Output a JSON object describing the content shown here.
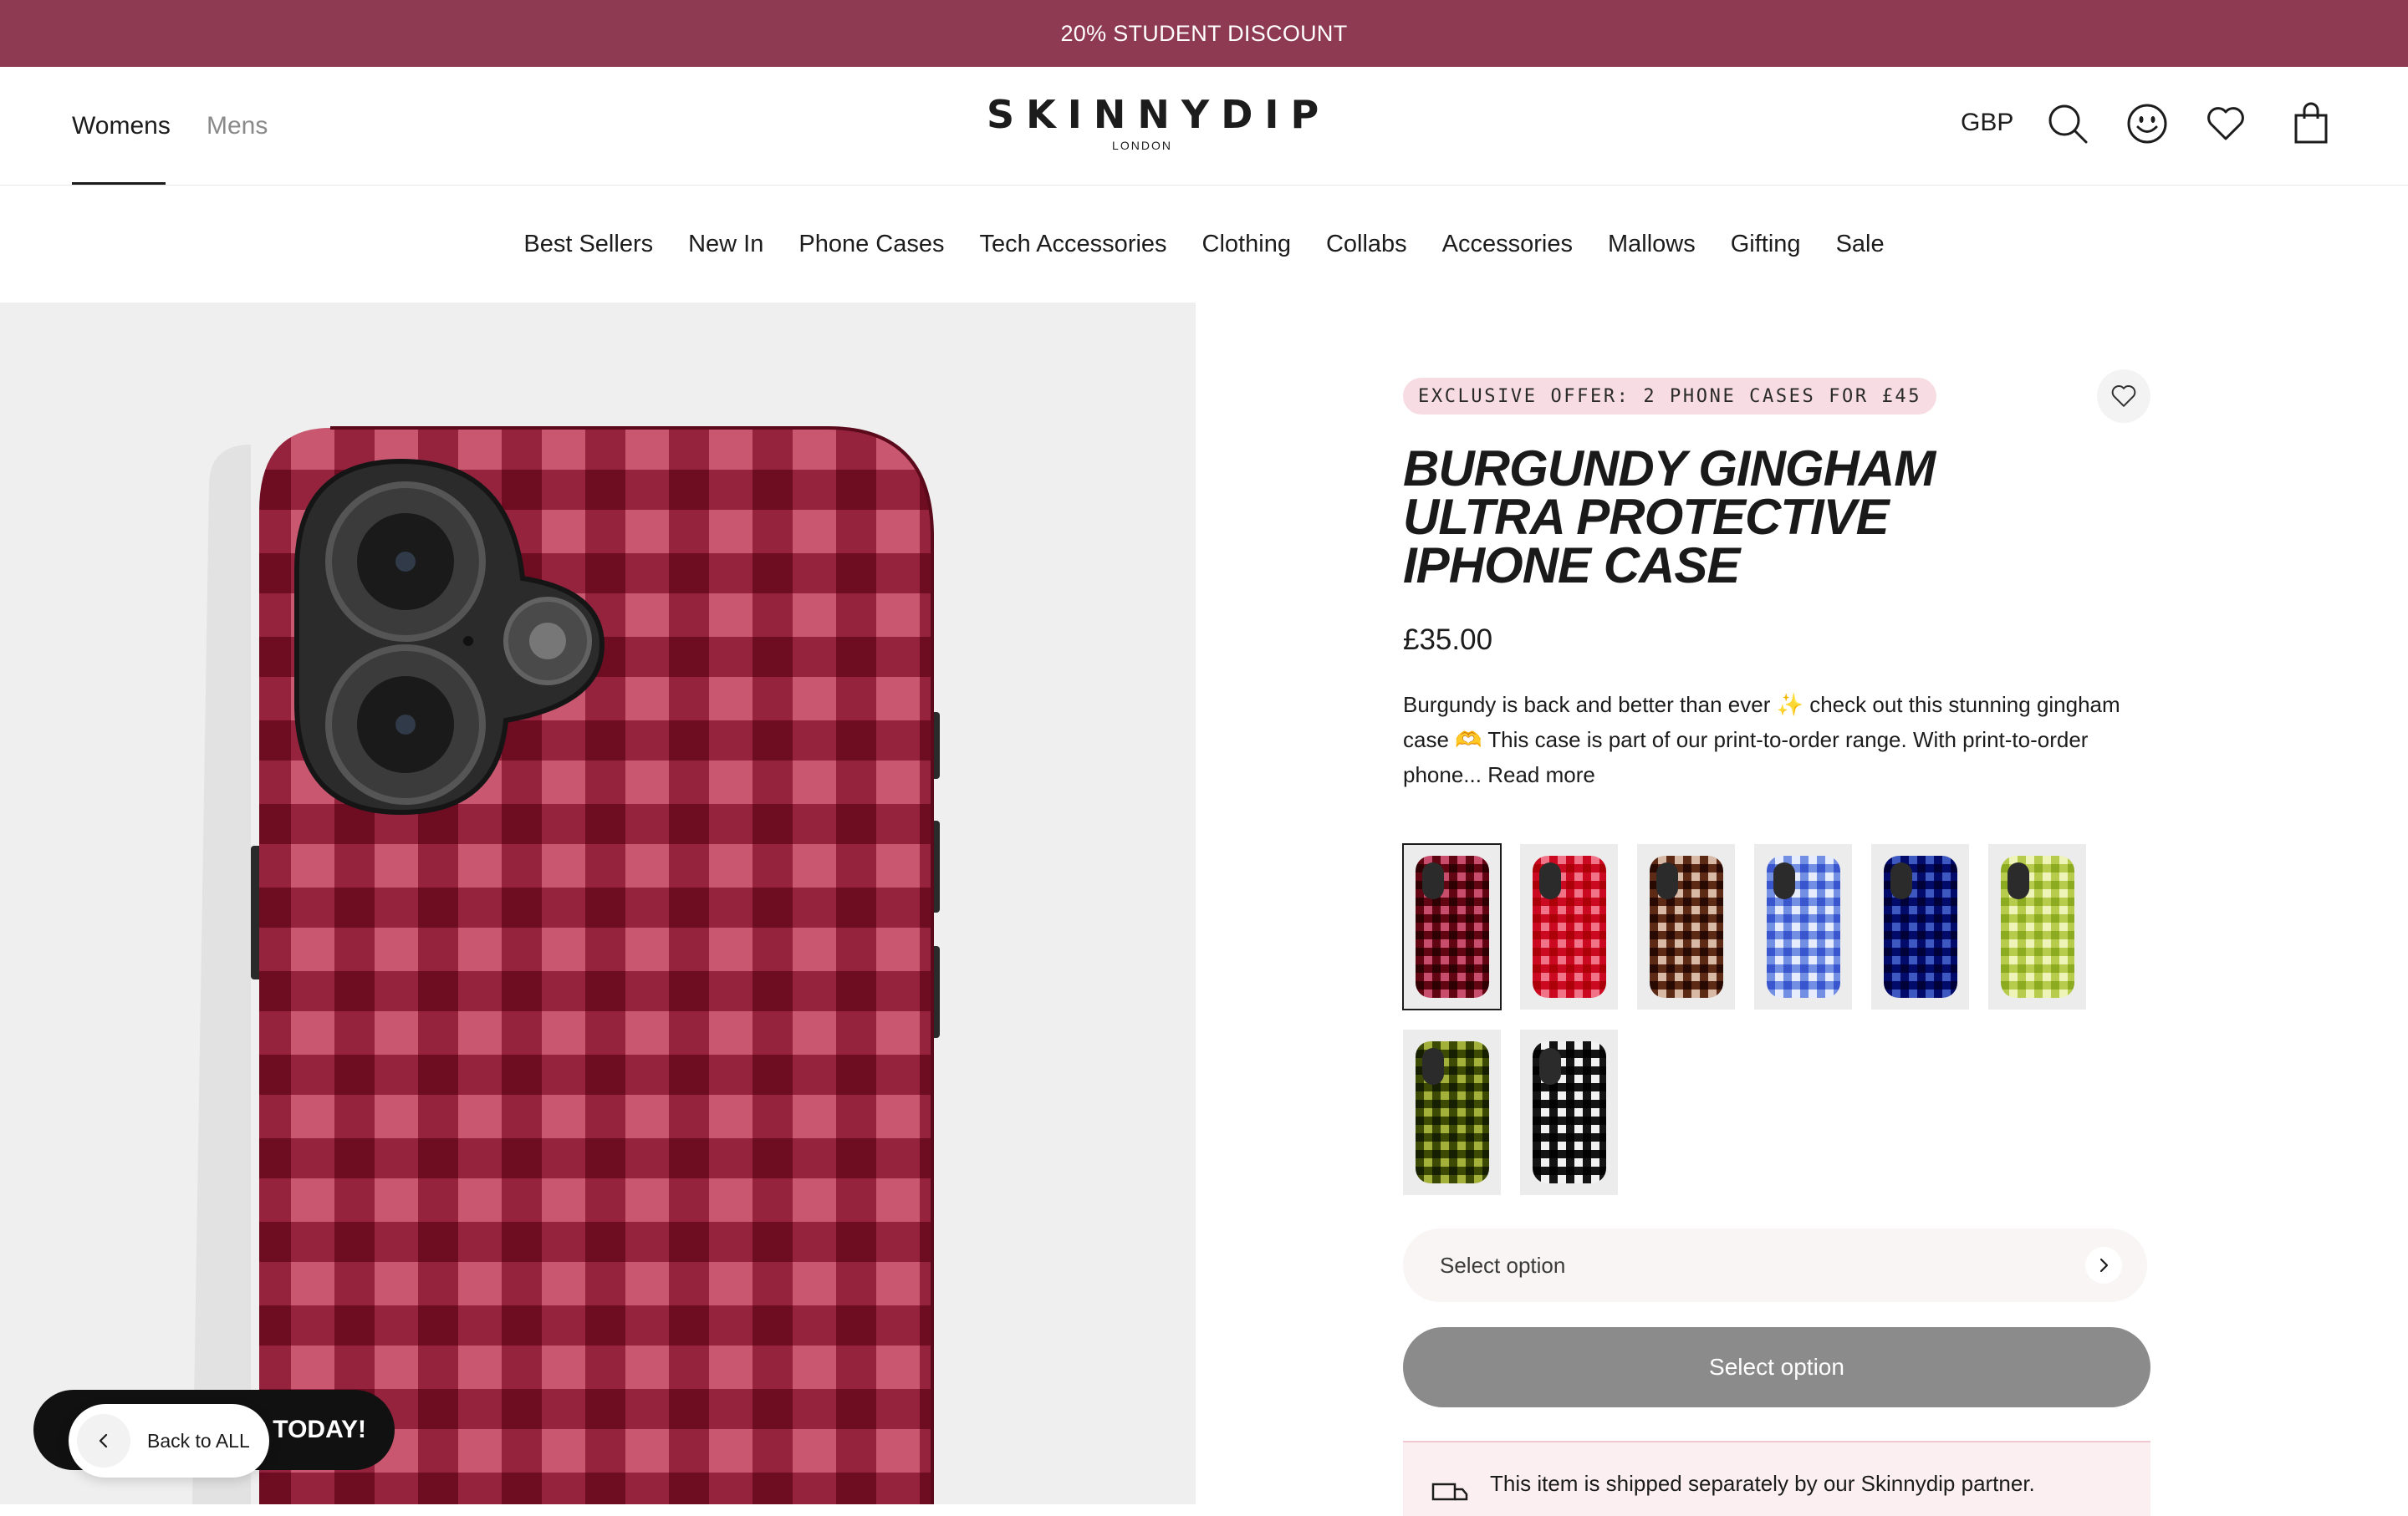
{
  "announcement": "20% STUDENT DISCOUNT",
  "header": {
    "gender_tabs": [
      "Womens",
      "Mens"
    ],
    "logo": {
      "word": "SKINNYDIP",
      "sub": "LONDON"
    },
    "currency": "GBP",
    "icons": [
      "search-icon",
      "account-smiley-icon",
      "wishlist-heart-icon",
      "bag-icon"
    ]
  },
  "nav": [
    "Best Sellers",
    "New In",
    "Phone Cases",
    "Tech Accessories",
    "Clothing",
    "Collabs",
    "Accessories",
    "Mallows",
    "Gifting",
    "Sale"
  ],
  "product": {
    "offer_badge": "EXCLUSIVE OFFER: 2 PHONE CASES FOR £45",
    "title_line1": "BURGUNDY GINGHAM",
    "title_line2": "ULTRA PROTECTIVE",
    "title_line3": "IPHONE CASE",
    "price": "£35.00",
    "desc_part1": "Burgundy is back and better than ever",
    "desc_emoji1": "✨",
    "desc_part2": " check out this stunning gingham case",
    "desc_emoji2": "🫶",
    "desc_part3": " This case is part of our print-to-order range. With print-to-order phone...",
    "read_more": "Read more",
    "swatch_colors": [
      {
        "dark": "#7a1028",
        "light": "#c84d6c"
      },
      {
        "dark": "#d8173d",
        "light": "#f07388"
      },
      {
        "dark": "#6e3a22",
        "light": "#d8b9a6"
      },
      {
        "dark": "#7f9ae8",
        "light": "#e6ecfb"
      },
      {
        "dark": "#0a1f8a",
        "light": "#3e58c2"
      },
      {
        "dark": "#c4d66a",
        "light": "#eef3b8"
      },
      {
        "dark": "#5e6a12",
        "light": "#a3b13a"
      },
      {
        "dark": "#151515",
        "light": "#f2f2f2"
      }
    ],
    "select_placeholder": "Select option",
    "add_button": "Select option",
    "shipping_note": "This item is shipped separately by our Skinnydip partner."
  },
  "widgets": {
    "promo_text": "P TODAY!",
    "back_label": "Back to ALL"
  },
  "colors": {
    "announcement_bg": "#8e3a52",
    "case_dark": "#7a1028",
    "case_light": "#c8576f"
  }
}
